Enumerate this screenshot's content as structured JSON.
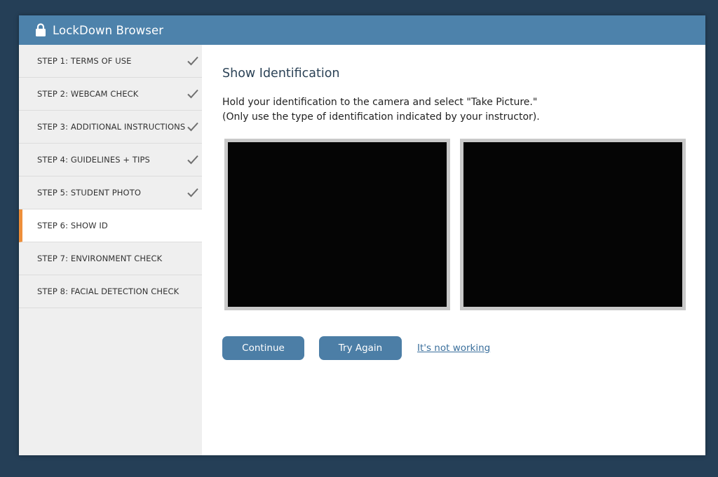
{
  "window": {
    "title": "LockDown Browser",
    "accent_color": "#4d82ab",
    "active_marker_color": "#ee8f3a"
  },
  "sidebar": {
    "steps": [
      {
        "label": "STEP 1: TERMS OF USE",
        "completed": true,
        "active": false
      },
      {
        "label": "STEP 2: WEBCAM CHECK",
        "completed": true,
        "active": false
      },
      {
        "label": "STEP 3: ADDITIONAL INSTRUCTIONS",
        "completed": true,
        "active": false
      },
      {
        "label": "STEP 4: GUIDELINES + TIPS",
        "completed": true,
        "active": false
      },
      {
        "label": "STEP 5: STUDENT PHOTO",
        "completed": true,
        "active": false
      },
      {
        "label": "STEP 6: SHOW ID",
        "completed": false,
        "active": true
      },
      {
        "label": "STEP 7: ENVIRONMENT CHECK",
        "completed": false,
        "active": false
      },
      {
        "label": "STEP 8: FACIAL DETECTION CHECK",
        "completed": false,
        "active": false
      }
    ]
  },
  "main": {
    "heading": "Show Identification",
    "instruction_line1": "Hold your identification to the camera and select \"Take Picture.\"",
    "instruction_line2": "(Only use the type of identification indicated by your instructor).",
    "buttons": {
      "continue_label": "Continue",
      "try_again_label": "Try Again",
      "not_working_label": "It's not working"
    }
  }
}
